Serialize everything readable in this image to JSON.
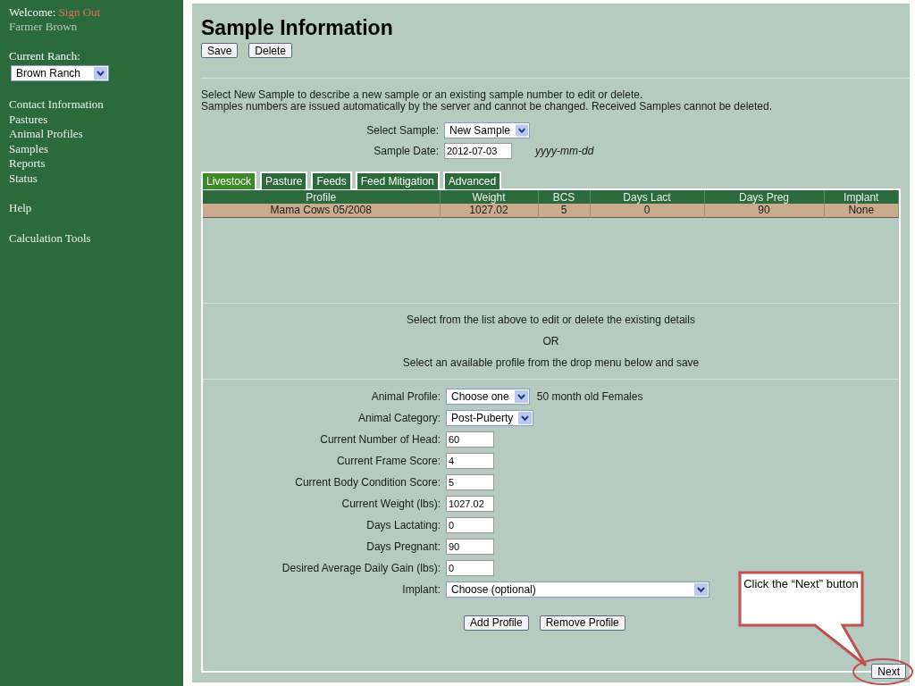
{
  "sidebar": {
    "welcome_label": "Welcome:",
    "sign_out": "Sign Out",
    "user_name": "Farmer Brown",
    "ranch_label": "Current Ranch:",
    "ranch_select": "Brown Ranch",
    "menu_groups": [
      [
        "Contact Information",
        "Pastures",
        "Animal Profiles",
        "Samples",
        "Reports",
        "Status"
      ],
      [
        "Help"
      ],
      [
        "Calculation Tools"
      ]
    ]
  },
  "page": {
    "title": "Sample Information",
    "top_buttons": [
      "Save",
      "Delete"
    ],
    "intro": [
      "Select New Sample to describe a new sample or an existing sample number to edit or delete.",
      "Samples numbers are issued automatically by the server and cannot be changed. Received Samples cannot be deleted."
    ],
    "select_sample": {
      "label": "Select Sample:",
      "value": "New Sample"
    },
    "sample_date": {
      "label": "Sample Date:",
      "value": "2012-07-03",
      "hint": "yyyy-mm-dd"
    },
    "tabs": [
      {
        "label": "Livestock",
        "selected": true
      },
      {
        "label": "Pasture",
        "selected": false
      },
      {
        "label": "Feeds",
        "selected": false
      },
      {
        "label": "Feed Mitigation",
        "selected": false
      },
      {
        "label": "Advanced",
        "selected": false
      }
    ],
    "table": {
      "columns": [
        "Profile",
        "Weight",
        "BCS",
        "Days Lact",
        "Days Preg",
        "Implant"
      ],
      "rows": [
        [
          "Mama Cows 05/2008",
          "1027.02",
          "5",
          "0",
          "90",
          "None"
        ]
      ]
    },
    "instructions": [
      "Select from the list above to edit or delete the existing details",
      "OR",
      "Select an available profile from the drop menu below and save"
    ],
    "form": [
      {
        "kind": "select",
        "label": "Animal Profile:",
        "value": "Choose one",
        "note": "50 month old Females"
      },
      {
        "kind": "select",
        "label": "Animal Category:",
        "value": "Post-Puberty"
      },
      {
        "kind": "input",
        "label": "Current Number of Head:",
        "value": "60"
      },
      {
        "kind": "input",
        "label": "Current Frame Score:",
        "value": "4"
      },
      {
        "kind": "input",
        "label": "Current Body Condition Score:",
        "value": "5"
      },
      {
        "kind": "input",
        "label": "Current Weight (lbs):",
        "value": "1027.02"
      },
      {
        "kind": "input",
        "label": "Days Lactating:",
        "value": "0"
      },
      {
        "kind": "input",
        "label": "Days Pregnant:",
        "value": "90"
      },
      {
        "kind": "input",
        "label": "Desired Average Daily Gain (lbs):",
        "value": "0"
      },
      {
        "kind": "wideselect",
        "label": "Implant:",
        "value": "Choose (optional)"
      }
    ],
    "form_buttons": [
      "Add Profile",
      "Remove Profile"
    ],
    "next_button": "Next"
  },
  "callout": {
    "text": "Click the “Next” button"
  }
}
